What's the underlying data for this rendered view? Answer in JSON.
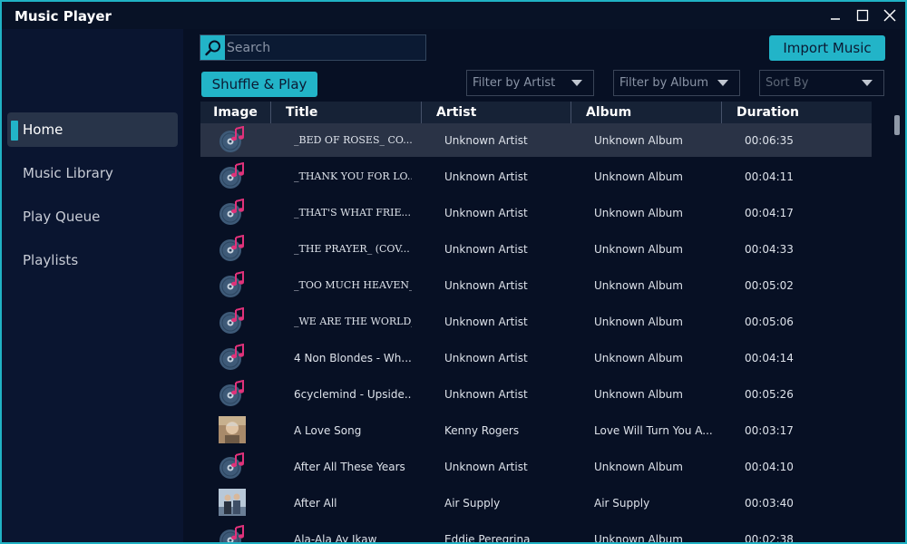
{
  "window": {
    "title": "Music Player",
    "minimize_icon": "minimize-icon",
    "maximize_icon": "maximize-icon",
    "close_icon": "close-icon"
  },
  "sidebar": {
    "items": [
      {
        "label": "Home",
        "active": true
      },
      {
        "label": "Music Library",
        "active": false
      },
      {
        "label": "Play Queue",
        "active": false
      },
      {
        "label": "Playlists",
        "active": false
      }
    ]
  },
  "toolbar": {
    "search_placeholder": "Search",
    "search_value": "",
    "import_label": "Import Music",
    "shuffle_label": "Shuffle & Play",
    "filter_artist": "Filter by Artist",
    "filter_album": "Filter by Album",
    "sort_by": "Sort By"
  },
  "table": {
    "columns": [
      "Image",
      "Title",
      "Artist",
      "Album",
      "Duration"
    ],
    "rows": [
      {
        "title": "_BED OF ROSES_ CO...",
        "artist": "Unknown Artist",
        "album": "Unknown Album",
        "duration": "00:06:35",
        "art": "disc",
        "selected": true,
        "mono": true
      },
      {
        "title": "_THANK YOU FOR LO...",
        "artist": "Unknown Artist",
        "album": "Unknown Album",
        "duration": "00:04:11",
        "art": "disc",
        "mono": true
      },
      {
        "title": "_THAT'S WHAT FRIE...",
        "artist": "Unknown Artist",
        "album": "Unknown Album",
        "duration": "00:04:17",
        "art": "disc",
        "mono": true
      },
      {
        "title": "_THE PRAYER_ (COV...",
        "artist": "Unknown Artist",
        "album": "Unknown Album",
        "duration": "00:04:33",
        "art": "disc",
        "mono": true
      },
      {
        "title": "_TOO MUCH HEAVEN_ ...",
        "artist": "Unknown Artist",
        "album": "Unknown Album",
        "duration": "00:05:02",
        "art": "disc",
        "mono": true
      },
      {
        "title": "_WE ARE THE WORLD_...",
        "artist": "Unknown Artist",
        "album": "Unknown Album",
        "duration": "00:05:06",
        "art": "disc",
        "mono": true
      },
      {
        "title": "4 Non Blondes - Wh...",
        "artist": "Unknown Artist",
        "album": "Unknown Album",
        "duration": "00:04:14",
        "art": "disc"
      },
      {
        "title": "6cyclemind - Upside...",
        "artist": "Unknown Artist",
        "album": "Unknown Album",
        "duration": "00:05:26",
        "art": "disc"
      },
      {
        "title": "A Love Song",
        "artist": "Kenny Rogers",
        "album": "Love Will Turn You A...",
        "duration": "00:03:17",
        "art": "photo-portrait"
      },
      {
        "title": "After All These Years",
        "artist": "Unknown Artist",
        "album": "Unknown Album",
        "duration": "00:04:10",
        "art": "disc"
      },
      {
        "title": "After All",
        "artist": "Air Supply",
        "album": "Air Supply",
        "duration": "00:03:40",
        "art": "photo-duo"
      },
      {
        "title": "Ala-Ala Ay Ikaw",
        "artist": "Eddie Peregrina",
        "album": "Unknown Album",
        "duration": "00:02:38",
        "art": "disc"
      }
    ]
  },
  "colors": {
    "accent": "#22b4c8",
    "background": "#071024",
    "sidebar": "#0a1530",
    "selected_row": "#2a3346",
    "note": "#e0327a",
    "disc": "#3e5a78"
  }
}
